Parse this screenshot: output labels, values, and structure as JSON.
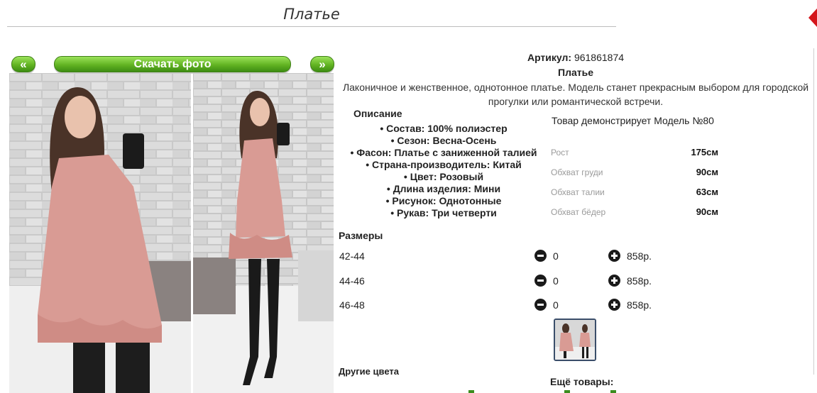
{
  "page": {
    "title": "Платье"
  },
  "gallery": {
    "prev_label": "«",
    "next_label": "»",
    "download_label": "Скачать фото"
  },
  "product": {
    "article_label": "Артикул:",
    "article": "961861874",
    "name": "Платье",
    "description": "Лаконичное и женственное, однотонное платье. Модель станет прекрасным выбором для городской прогулки или романтической встречи."
  },
  "description_section": {
    "heading": "Описание",
    "features": [
      "Состав: 100% полиэстер",
      "Сезон: Весна-Осень",
      "Фасон: Платье с заниженной талией",
      "Страна-производитель: Китай",
      "Цвет: Розовый",
      "Длина изделия: Мини",
      "Рисунок: Однотонные",
      "Рукав: Три четверти"
    ]
  },
  "model": {
    "text": "Товар демонстрирует Модель №80",
    "measurements": [
      {
        "label": "Рост",
        "value": "175см"
      },
      {
        "label": "Обхват груди",
        "value": "90см"
      },
      {
        "label": "Обхват талии",
        "value": "63см"
      },
      {
        "label": "Обхват бёдер",
        "value": "90см"
      }
    ]
  },
  "sizes": {
    "heading": "Размеры",
    "rows": [
      {
        "size": "42-44",
        "qty": "0",
        "price": "858р."
      },
      {
        "size": "44-46",
        "qty": "0",
        "price": "858р."
      },
      {
        "size": "46-48",
        "qty": "0",
        "price": "858р."
      }
    ]
  },
  "footer": {
    "other_colors": "Другие цвета",
    "more_products": "Ещё товары:"
  },
  "colors": {
    "button_green": "#62b322",
    "dress_pink": "#d99b94",
    "thumb_border": "#3a4e6a",
    "side_marker_red": "#d4151b"
  }
}
